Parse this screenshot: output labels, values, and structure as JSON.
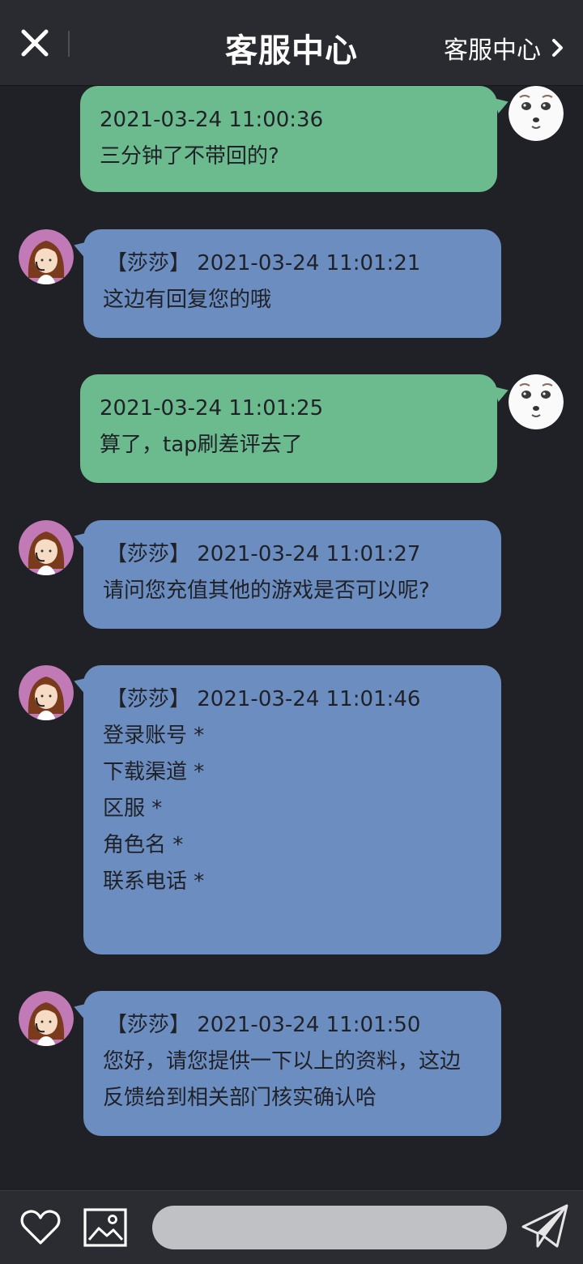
{
  "header": {
    "title": "客服中心",
    "link_label": "客服中心"
  },
  "messages": [
    {
      "sender": "user",
      "lines": [
        "2021-03-24 11:00:36",
        "三分钟了不带回的?"
      ]
    },
    {
      "sender": "agent",
      "lines": [
        "【莎莎】 2021-03-24 11:01:21",
        "这边有回复您的哦"
      ]
    },
    {
      "sender": "user",
      "lines": [
        "2021-03-24 11:01:25",
        "算了，tap刷差评去了"
      ]
    },
    {
      "sender": "agent",
      "lines": [
        "【莎莎】 2021-03-24 11:01:27",
        "请问您充值其他的游戏是否可以呢?"
      ]
    },
    {
      "sender": "agent",
      "lines": [
        "【莎莎】 2021-03-24 11:01:46",
        "登录账号 *",
        "下载渠道 *",
        "区服 *",
        "角色名 *",
        "联系电话 *"
      ]
    },
    {
      "sender": "agent",
      "lines": [
        "【莎莎】 2021-03-24 11:01:50",
        "您好，请您提供一下以上的资料，这边",
        "反馈给到相关部门核实确认哈"
      ]
    }
  ],
  "composer": {
    "value": "",
    "placeholder": ""
  },
  "colors": {
    "background": "#202126",
    "header": "#2a2b30",
    "user_bubble": "#6cbb8f",
    "agent_bubble": "#6c8dbf",
    "input": "#c0c1c4"
  }
}
